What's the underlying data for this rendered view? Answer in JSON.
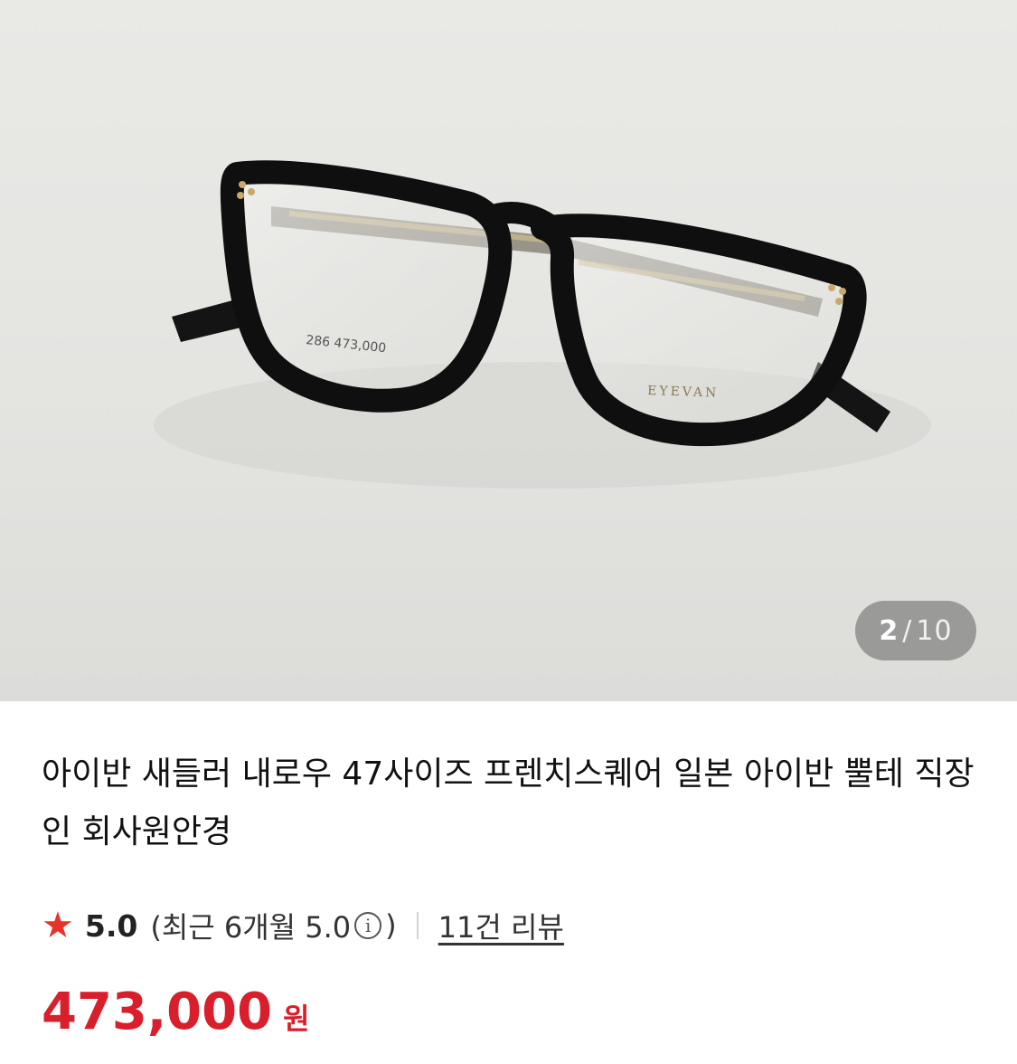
{
  "product_image": {
    "description_icon": "eyeglasses-photo",
    "tag_text": "286 473,000",
    "lens_brand": "EYEVAN"
  },
  "gallery": {
    "current": "2",
    "separator": "/",
    "total": "10"
  },
  "product": {
    "title": "아이반 새들러 내로우 47사이즈 프렌치스퀘어 일본 아이반 뿔테 직장인 회사원안경"
  },
  "rating": {
    "icon": "star-icon",
    "score": "5.0",
    "recent_label": "(최근 6개월 5.0",
    "info_glyph": "i",
    "recent_close": ")",
    "review_count": "11건 리뷰"
  },
  "price": {
    "amount": "473,000",
    "currency": "원"
  },
  "colors": {
    "accent_red": "#d91f2b",
    "star": "#e8322a"
  }
}
